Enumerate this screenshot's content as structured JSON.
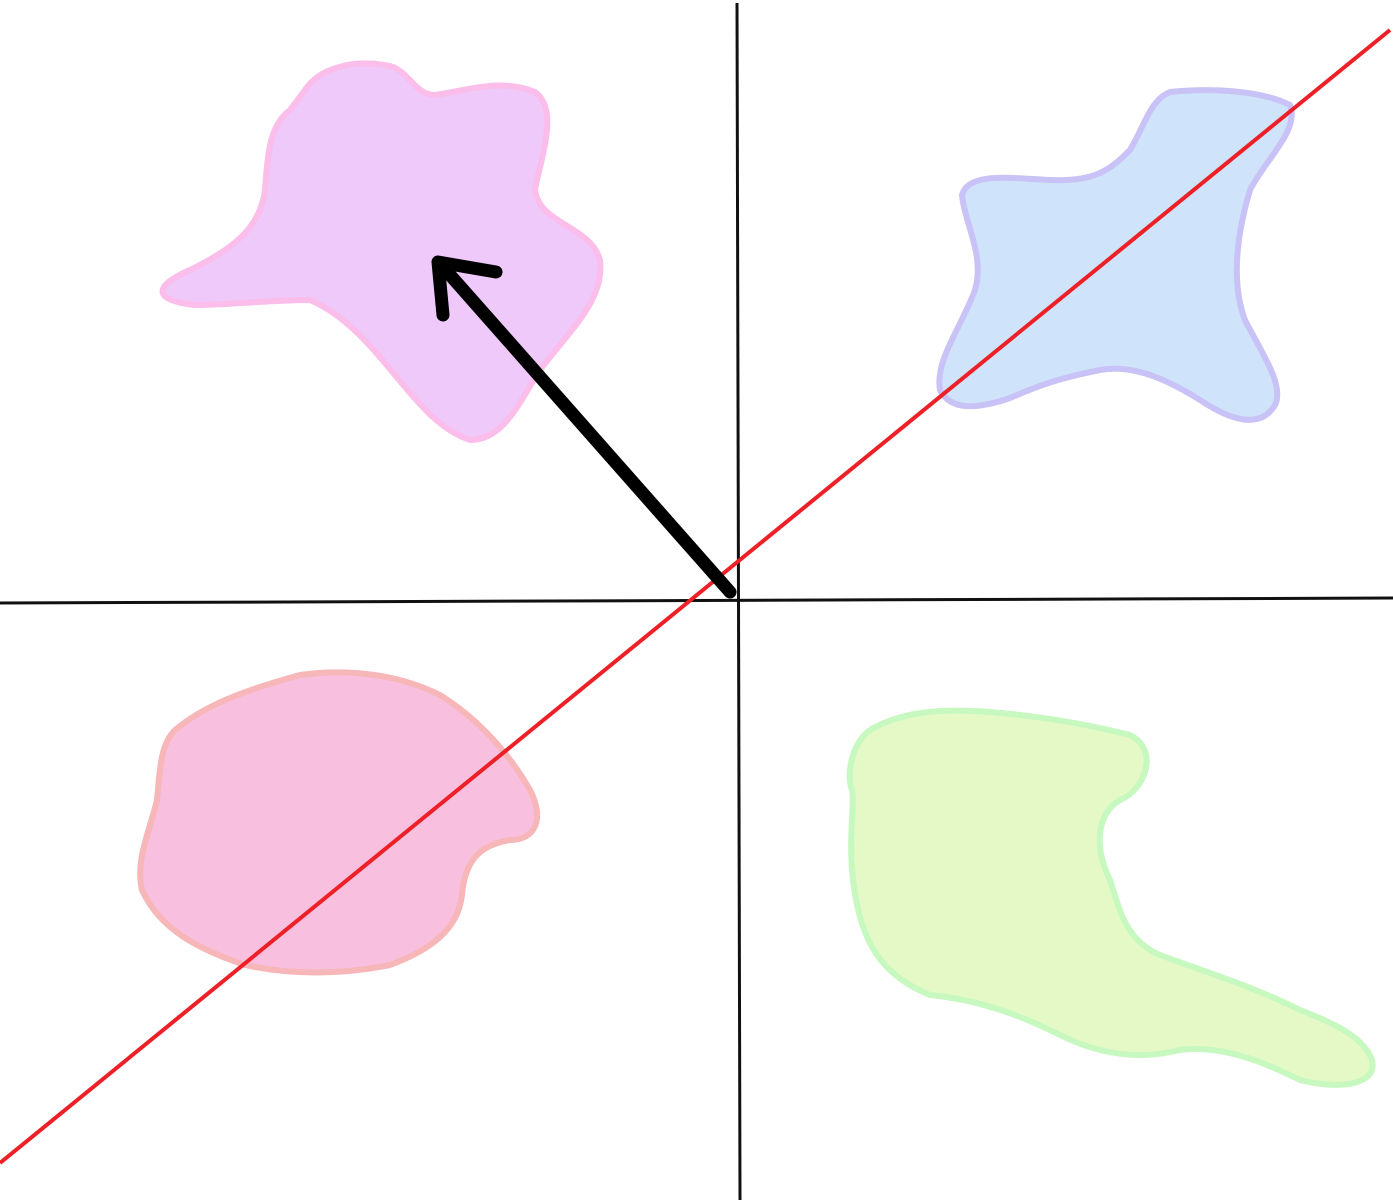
{
  "diagram": {
    "background": "#ffffff",
    "axes": {
      "color": "#111111"
    },
    "arrow": {
      "color": "#000000",
      "description_name": "vector-arrow"
    },
    "line": {
      "color": "#ee2027"
    },
    "regions": [
      {
        "name": "region-top-left",
        "fill": "#eec9f9",
        "stroke": "#fbbde9"
      },
      {
        "name": "region-top-right",
        "fill": "#cfe4fa",
        "stroke": "#c8c2f6"
      },
      {
        "name": "region-bottom-left",
        "fill": "#f8bfdf",
        "stroke": "#f7b6b8"
      },
      {
        "name": "region-bottom-right",
        "fill": "#e5f9c6",
        "stroke": "#c6f8c0"
      }
    ]
  }
}
